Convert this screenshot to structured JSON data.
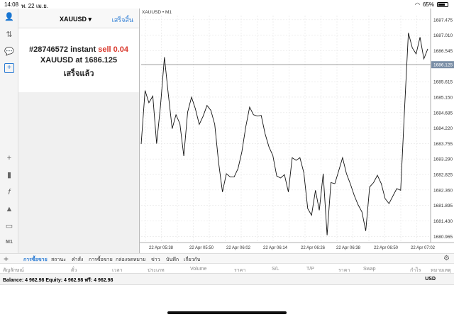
{
  "status": {
    "time": "14:08",
    "date": "พ. 22 เม.ย.",
    "battery": "65%"
  },
  "sidebar": {
    "icons": [
      "person-icon",
      "exchange-icon",
      "chat-icon",
      "new-order-icon",
      "crosshair-icon",
      "candles-icon",
      "function-icon",
      "objects-icon",
      "monitor-icon"
    ],
    "timeframe": "M1"
  },
  "order_panel": {
    "symbol": "XAUUSD",
    "done_label": "เสร็จสิ้น",
    "ticket": "#28746572 instant",
    "action": "sell 0.04",
    "line2_prefix": "XAUUSD at",
    "price": "1686.125",
    "status": "เสร็จแล้ว",
    "sell_color": "#d9372b"
  },
  "chart": {
    "title": "XAUUSD • M1",
    "current_price_label": "1686.125"
  },
  "chart_data": {
    "type": "line",
    "title": "XAUUSD • M1",
    "x_ticks": [
      "22 Apr 05:38",
      "22 Apr 05:50",
      "22 Apr 06:02",
      "22 Apr 06:14",
      "22 Apr 06:26",
      "22 Apr 06:38",
      "22 Apr 06:50",
      "22 Apr 07:02"
    ],
    "y_ticks": [
      "1687.475",
      "1687.010",
      "1686.545",
      "1686.125",
      "1685.615",
      "1685.150",
      "1684.685",
      "1684.220",
      "1683.755",
      "1683.290",
      "1682.825",
      "1682.360",
      "1681.895",
      "1681.430",
      "1680.965"
    ],
    "ylim": [
      1680.78,
      1687.6
    ],
    "values": [
      1683.74,
      1685.35,
      1684.98,
      1685.18,
      1683.75,
      1684.9,
      1686.35,
      1685.25,
      1684.2,
      1684.62,
      1684.35,
      1683.38,
      1684.7,
      1685.15,
      1684.8,
      1684.33,
      1684.58,
      1684.9,
      1684.75,
      1684.33,
      1683.18,
      1682.3,
      1682.85,
      1682.75,
      1682.75,
      1683.0,
      1683.5,
      1684.25,
      1684.85,
      1684.62,
      1684.58,
      1684.6,
      1684.05,
      1683.65,
      1683.4,
      1682.78,
      1682.72,
      1682.82,
      1682.3,
      1683.33,
      1683.25,
      1683.33,
      1682.88,
      1681.8,
      1681.6,
      1682.35,
      1681.75,
      1682.85,
      1681.0,
      1682.58,
      1682.55,
      1682.93,
      1683.33,
      1682.85,
      1682.55,
      1682.2,
      1681.92,
      1681.7,
      1681.13,
      1682.45,
      1682.58,
      1682.8,
      1682.55,
      1682.1,
      1681.95,
      1682.18,
      1682.4,
      1682.35,
      1684.75,
      1687.08,
      1686.63,
      1686.45,
      1686.95,
      1686.3,
      1686.6
    ],
    "current_price": 1686.125,
    "grid": true
  },
  "tabs": [
    "การซื้อขาย",
    "สถานะ",
    "คำสั่ง",
    "การซื้อขาย",
    "กล่องจดหมาย",
    "ข่าว",
    "บันทึก",
    "เกี่ยวกับ"
  ],
  "columns": [
    "สัญลักษณ์",
    "ตั๋ว",
    "เวลา",
    "ประเภท",
    "Volume",
    "ราคา",
    "S/L",
    "T/P",
    "ราคา",
    "Swap",
    "กำไร",
    "หมายเหตุ"
  ],
  "balance": {
    "text": "Balance: 4 962.98  Equity: 4 962.98  ฟรี: 4 962.98",
    "currency": "USD"
  }
}
